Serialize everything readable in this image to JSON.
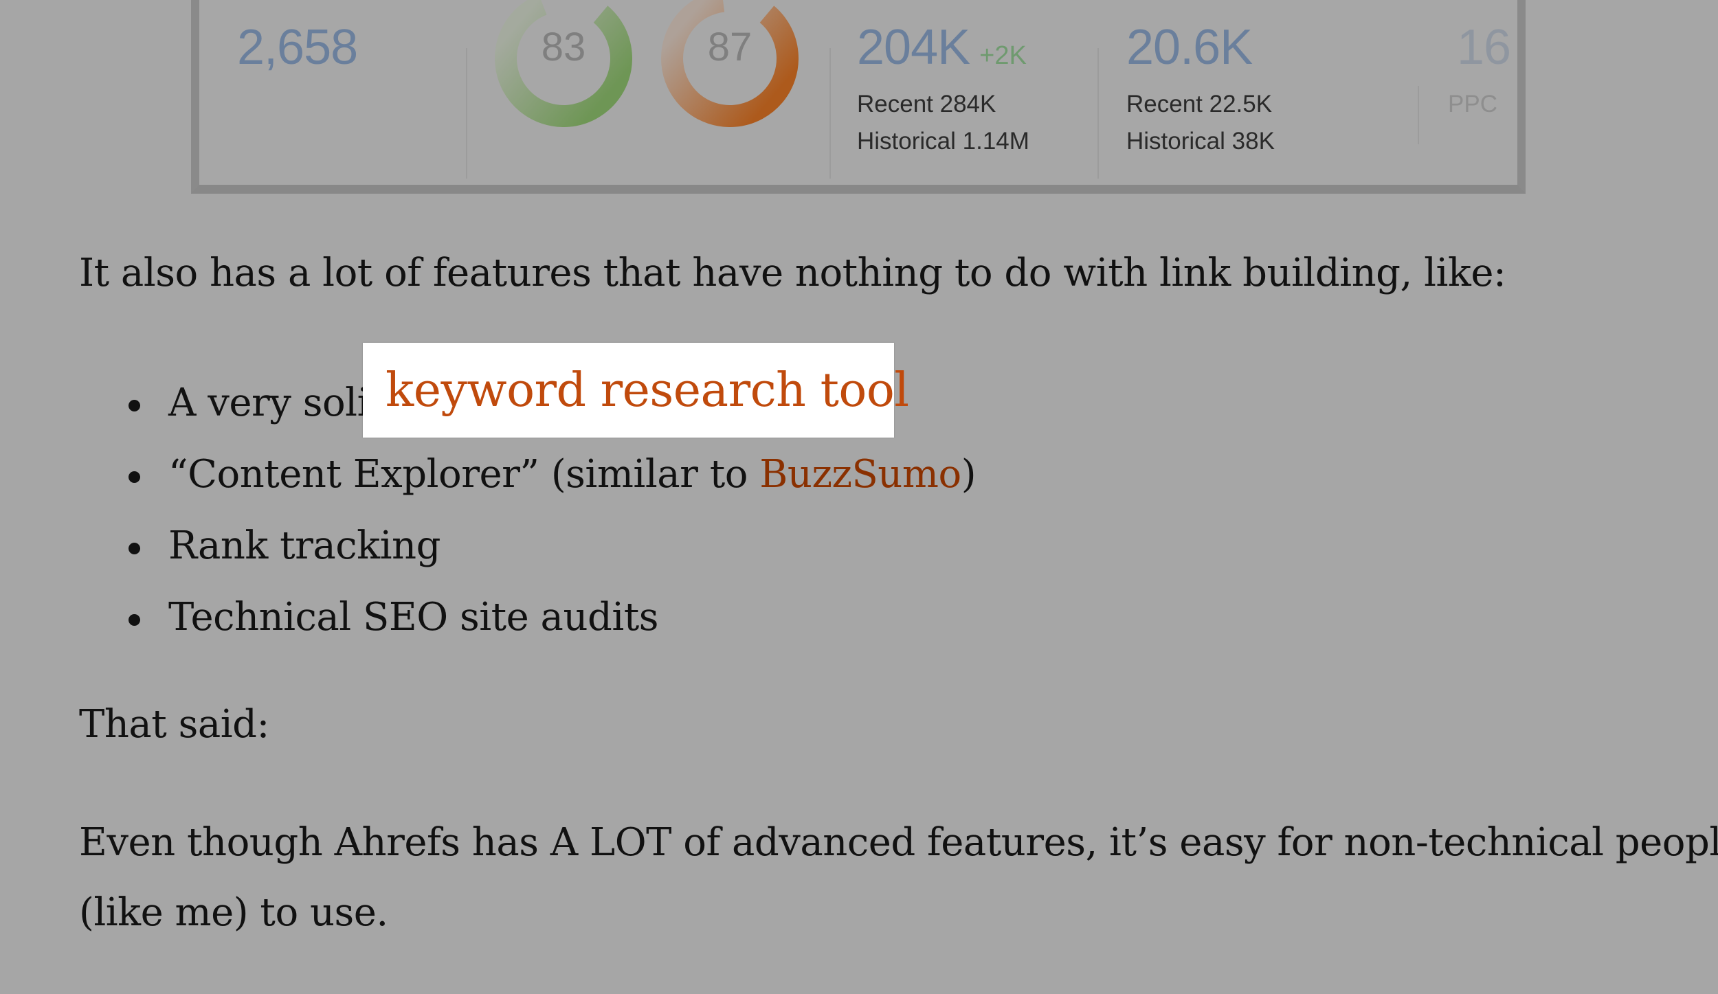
{
  "metrics_panel": {
    "domain_rating_backlinks": "2,658",
    "ring_1": {
      "value": "83",
      "percent": 83,
      "color": "#6f9a5a"
    },
    "ring_2": {
      "value": "87",
      "percent": 87,
      "color": "#b06020"
    },
    "backlinks": {
      "value": "204K",
      "delta": "+2K",
      "recent": "Recent 284K",
      "historical": "Historical 1.14M"
    },
    "referring_domains": {
      "value": "20.6K",
      "recent": "Recent 22.5K",
      "historical": "Historical 38K"
    },
    "cutoff": {
      "value": "16",
      "label": "PPC"
    }
  },
  "article": {
    "intro": "It also has a lot of features that have nothing to do with link building, like:",
    "features": [
      {
        "text": "A very solid ",
        "link": "keyword research tool"
      },
      {
        "prefix": "“Content Explorer” (similar to ",
        "link": "BuzzSumo",
        "suffix": ")"
      },
      {
        "text": "Rank tracking"
      },
      {
        "text": "Technical SEO site audits"
      }
    ],
    "that_said": "That said:",
    "closing_line1": "Even though Ahrefs has A LOT of advanced features, it’s easy for non-technical people",
    "closing_line2": "(like me) to use."
  },
  "highlight": {
    "text": "keyword research tool",
    "color": "#c04a0c"
  }
}
